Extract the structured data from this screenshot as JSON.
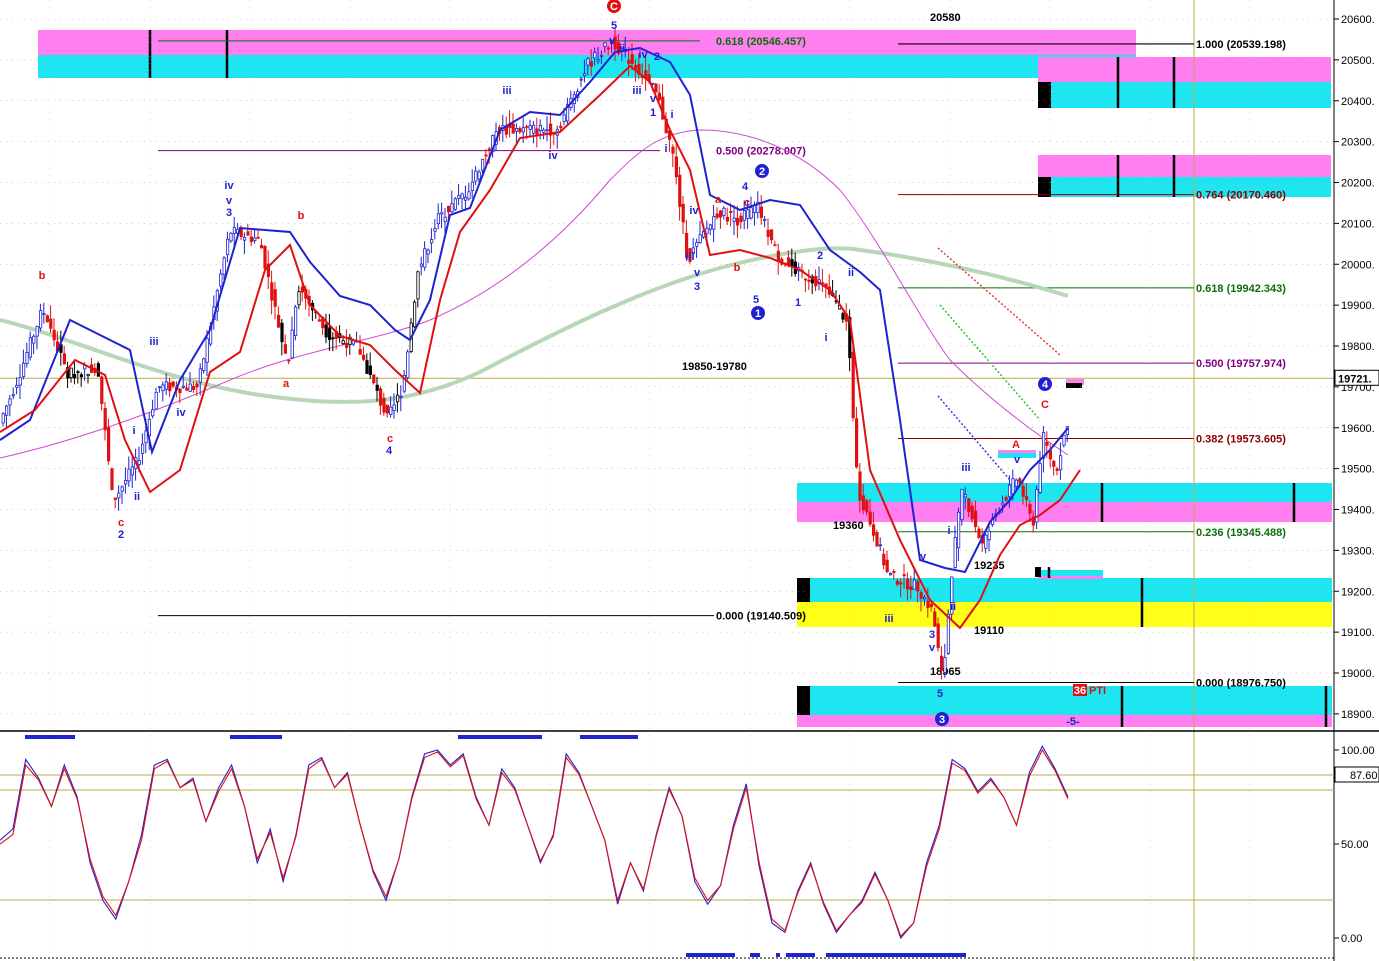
{
  "colors": {
    "blue": "#1e22d0",
    "red": "#e01010",
    "green": "#0b6e0b",
    "darkred": "#8b0000",
    "purple": "#800080",
    "maroon": "#6b0000",
    "magenta": "#ff7ef0",
    "cyan": "#1ee6f0",
    "yellow": "#ffff1a",
    "olive": "#b9ad48",
    "ma_green": "#b8d6b8",
    "ma_pink": "#d04bd0"
  },
  "price_axis": {
    "ticks": [
      "20600.",
      "20500.",
      "20400.",
      "20300.",
      "20200.",
      "20100.",
      "20000.",
      "19900.",
      "19800.",
      "19700.",
      "19600.",
      "19500.",
      "19400.",
      "19300.",
      "19200.",
      "19100.",
      "19000.",
      "18900."
    ],
    "last_price": "19721.",
    "range": [
      18860,
      20640
    ]
  },
  "osc_axis": {
    "ticks": [
      "100.00",
      "50.00",
      "0.00"
    ],
    "marker_value": "87.60",
    "range": [
      -5,
      105
    ]
  },
  "fib_levels": [
    {
      "text": "1.000 (20539.198)",
      "price": 20539.198,
      "color": "#000000"
    },
    {
      "text": "0.764 (20170.460)",
      "price": 20170.46,
      "color": "#8b0000"
    },
    {
      "text": "0.618 (19942.343)",
      "price": 19942.343,
      "color": "#0b6e0b"
    },
    {
      "text": "0.500 (19757.974)",
      "price": 19757.974,
      "color": "#800080"
    },
    {
      "text": "0.382 (19573.605)",
      "price": 19573.605,
      "color": "#8b0000"
    },
    {
      "text": "0.236 (19345.488)",
      "price": 19345.488,
      "color": "#0b6e0b"
    },
    {
      "text": "0.000 (18976.750)",
      "price": 18976.75,
      "color": "#000000"
    }
  ],
  "left_fib_levels": [
    {
      "text": "0.618 (20546.457)",
      "price": 20546.457,
      "color": "#0b6e0b"
    },
    {
      "text": "0.500 (20278.007)",
      "price": 20278.007,
      "color": "#800080"
    },
    {
      "text": "0.000 (19140.509)",
      "price": 19140.509,
      "color": "#000000"
    }
  ],
  "price_notes": [
    "20580",
    "19850-19780",
    "19360",
    "19235",
    "19110",
    "18965"
  ],
  "wave_labels": [
    {
      "t": "C",
      "c": "red",
      "circle": true
    },
    {
      "t": "5",
      "c": "blue"
    },
    {
      "t": "v",
      "c": "blue"
    },
    {
      "t": "ii",
      "c": "blue"
    },
    {
      "t": "iv",
      "c": "blue"
    },
    {
      "t": "2",
      "c": "blue"
    },
    {
      "t": "iii",
      "c": "blue"
    },
    {
      "t": "v",
      "c": "blue"
    },
    {
      "t": "1",
      "c": "blue"
    },
    {
      "t": "i",
      "c": "blue"
    },
    {
      "t": "i",
      "c": "blue"
    },
    {
      "t": "iii",
      "c": "blue"
    },
    {
      "t": "iv",
      "c": "blue"
    },
    {
      "t": "3",
      "c": "blue"
    },
    {
      "t": "v",
      "c": "blue"
    },
    {
      "t": "b",
      "c": "red"
    },
    {
      "t": "a",
      "c": "red"
    },
    {
      "t": "c",
      "c": "red"
    },
    {
      "t": "4",
      "c": "blue"
    },
    {
      "t": "b",
      "c": "red"
    },
    {
      "t": "c",
      "c": "red"
    },
    {
      "t": "2",
      "c": "blue"
    },
    {
      "t": "i",
      "c": "blue"
    },
    {
      "t": "ii",
      "c": "blue"
    },
    {
      "t": "iii",
      "c": "blue"
    },
    {
      "t": "iv",
      "c": "blue"
    },
    {
      "t": "iv",
      "c": "blue"
    },
    {
      "t": "iii",
      "c": "blue"
    },
    {
      "t": "iv",
      "c": "blue"
    },
    {
      "t": "v",
      "c": "blue"
    },
    {
      "t": "3",
      "c": "blue"
    },
    {
      "t": "a",
      "c": "red"
    },
    {
      "t": "4",
      "c": "blue"
    },
    {
      "t": "c",
      "c": "red"
    },
    {
      "t": "b",
      "c": "red"
    },
    {
      "t": "5",
      "c": "blue"
    },
    {
      "t": "1",
      "c": "blue",
      "circle": true
    },
    {
      "t": "2",
      "c": "blue",
      "circle": true
    },
    {
      "t": "1",
      "c": "blue"
    },
    {
      "t": "2",
      "c": "blue"
    },
    {
      "t": "ii",
      "c": "blue"
    },
    {
      "t": "i",
      "c": "blue"
    },
    {
      "t": "iii",
      "c": "blue"
    },
    {
      "t": "v",
      "c": "blue"
    },
    {
      "t": "3",
      "c": "blue"
    },
    {
      "t": "v",
      "c": "blue"
    },
    {
      "t": "i",
      "c": "blue"
    },
    {
      "t": "ii",
      "c": "blue"
    },
    {
      "t": "5",
      "c": "blue"
    },
    {
      "t": "3",
      "c": "blue",
      "circle": true
    },
    {
      "t": "iii",
      "c": "blue"
    },
    {
      "t": "v",
      "c": "blue"
    },
    {
      "t": "A",
      "c": "red"
    },
    {
      "t": "C",
      "c": "red"
    },
    {
      "t": "4",
      "c": "blue",
      "circle": true
    },
    {
      "t": "-5-",
      "c": "blue"
    }
  ],
  "pti": {
    "num": "36",
    "text": "PTI"
  },
  "chart_data": {
    "type": "candlestick",
    "title": "",
    "ylim": [
      18860,
      20640
    ],
    "y_ticks": [
      18900,
      19000,
      19100,
      19200,
      19300,
      19400,
      19500,
      19600,
      19700,
      19800,
      19900,
      20000,
      20100,
      20200,
      20300,
      20400,
      20500,
      20600
    ],
    "swing_points": [
      {
        "label": "b",
        "price": 19890
      },
      {
        "label": "c 2",
        "price": 19430
      },
      {
        "label": "3",
        "price": 20080
      },
      {
        "label": "b",
        "price": 20050
      },
      {
        "label": "c 4",
        "price": 19620
      },
      {
        "label": "C 5",
        "price": 20545
      },
      {
        "label": "iii 3",
        "price": 20000
      },
      {
        "label": "2 (circled)",
        "price": 20170
      },
      {
        "label": "1 (circled)",
        "price": 19870
      },
      {
        "label": "iii",
        "price": 19140
      },
      {
        "label": "3 5",
        "price": 18975
      },
      {
        "label": "C 4 (circled)",
        "price": 19630
      }
    ],
    "oscillator": {
      "type": "line",
      "ylim": [
        -5,
        105
      ],
      "ref_lines": [
        88,
        20
      ],
      "series": [
        {
          "color": "blue",
          "values": [
            52,
            58,
            95,
            85,
            70,
            92,
            75,
            40,
            20,
            10,
            30,
            55,
            92,
            95,
            80,
            85,
            62,
            80,
            92,
            70,
            40,
            58,
            30,
            55,
            92,
            96,
            80,
            88,
            60,
            35,
            20,
            42,
            75,
            98,
            100,
            92,
            98,
            75,
            60,
            90,
            80,
            60,
            40,
            55,
            98,
            88,
            70,
            52,
            18,
            40,
            25,
            55,
            80,
            65,
            30,
            18,
            28,
            60,
            82,
            38,
            8,
            3,
            25,
            40,
            18,
            3,
            12,
            20,
            35,
            20,
            0,
            8,
            40,
            60,
            95,
            90,
            78,
            85,
            75,
            60,
            88,
            102,
            90,
            75
          ]
        },
        {
          "color": "red",
          "values": [
            50,
            55,
            92,
            84,
            70,
            90,
            74,
            42,
            22,
            12,
            30,
            52,
            90,
            94,
            80,
            84,
            62,
            78,
            90,
            70,
            42,
            56,
            32,
            54,
            90,
            95,
            80,
            87,
            60,
            36,
            22,
            42,
            74,
            96,
            99,
            91,
            97,
            74,
            60,
            88,
            79,
            60,
            41,
            54,
            96,
            87,
            70,
            52,
            20,
            40,
            26,
            54,
            79,
            65,
            32,
            20,
            28,
            58,
            80,
            40,
            10,
            4,
            24,
            39,
            19,
            4,
            12,
            19,
            34,
            20,
            1,
            8,
            38,
            58,
            93,
            89,
            77,
            84,
            75,
            60,
            86,
            100,
            89,
            74
          ]
        }
      ]
    }
  }
}
